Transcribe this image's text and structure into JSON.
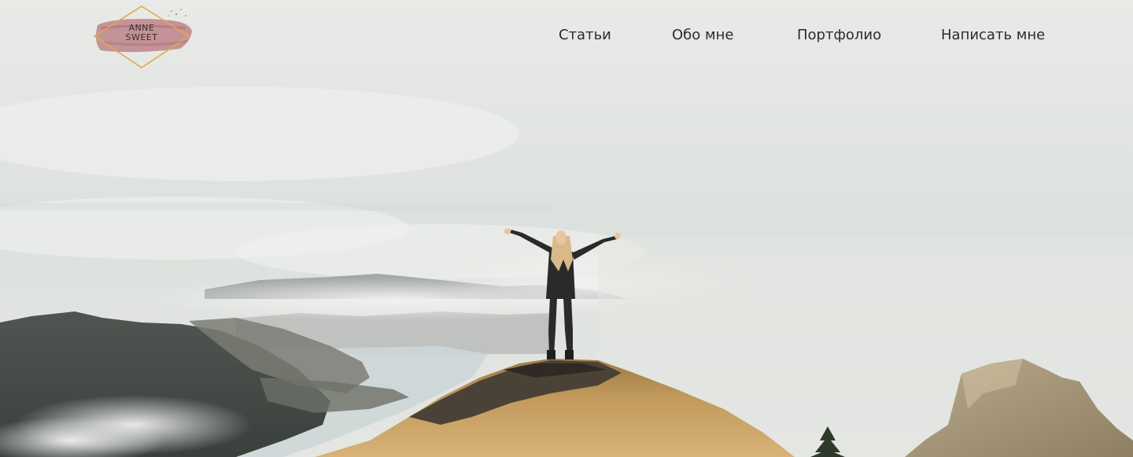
{
  "logo": {
    "line1": "ANNE",
    "line2": "SWEET"
  },
  "nav": {
    "items": [
      {
        "label": "Статьи"
      },
      {
        "label": "Обо мне"
      },
      {
        "label": "Портфолио"
      },
      {
        "label": "Написать мне"
      }
    ]
  },
  "hero": {
    "image": "woman-on-mountain-peak-photo"
  },
  "colors": {
    "nav_text": "#2b2b2b",
    "logo_brush": "#c08a8e",
    "logo_frame": "#e0a94a",
    "sky": "#e6e8e5"
  }
}
